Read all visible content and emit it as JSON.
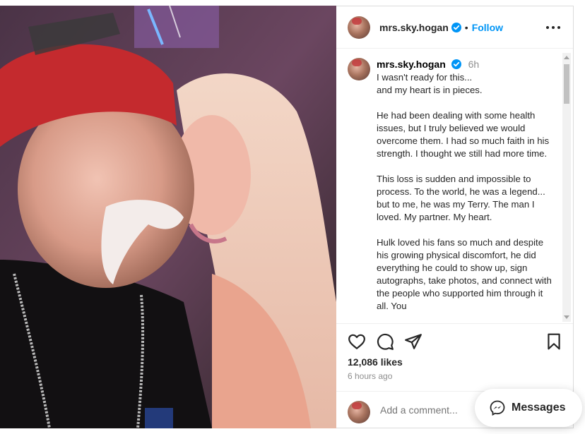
{
  "post": {
    "username": "mrs.sky.hogan",
    "follow_label": "Follow",
    "separator": "•",
    "time_ago": "6h",
    "caption": "I wasn't ready for this...\nand my heart is in pieces.\n\nHe had been dealing with some health issues, but I truly believed we would overcome them. I had so much faith in his strength. I thought we still had more time.\n\nThis loss is sudden and impossible to process. To the world, he was a legend... but to me, he was my Terry. The man I loved. My partner. My heart.\n\nHulk loved his fans so much and despite his growing physical discomfort, he did everything he could to show up, sign autographs, take photos, and connect with the people who supported him through it all. You",
    "likes": "12,086 likes",
    "posted_ago": "6 hours ago",
    "comment_placeholder": "Add a comment...",
    "verified_color": "#0095f6"
  },
  "icons": {
    "more": "more-options-icon",
    "like": "heart-icon",
    "comment": "comment-icon",
    "share": "send-icon",
    "save": "bookmark-icon",
    "verified": "verified-badge-icon",
    "messenger": "messenger-icon"
  },
  "messages": {
    "label": "Messages"
  }
}
